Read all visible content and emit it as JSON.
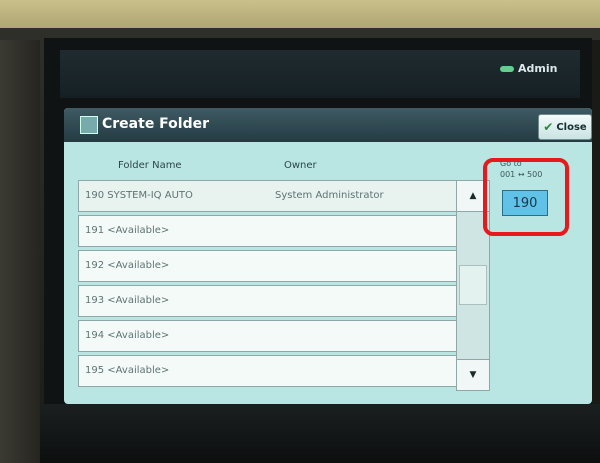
{
  "status": {
    "user_label": "Admin"
  },
  "dialog": {
    "title": "Create Folder",
    "close_label": "Close",
    "columns": {
      "folder_name": "Folder Name",
      "owner": "Owner"
    },
    "rows": [
      {
        "folder": "190 SYSTEM-IQ AUTO",
        "owner": "System Administrator"
      },
      {
        "folder": "191 <Available>",
        "owner": ""
      },
      {
        "folder": "192 <Available>",
        "owner": ""
      },
      {
        "folder": "193 <Available>",
        "owner": ""
      },
      {
        "folder": "194 <Available>",
        "owner": ""
      },
      {
        "folder": "195 <Available>",
        "owner": ""
      }
    ],
    "goto": {
      "label": "Go to",
      "range": "001 ↔ 500",
      "value": "190"
    }
  },
  "icons": {
    "user": "admin-key-icon",
    "title": "folder-tool-icon",
    "close": "checkmark-icon",
    "scroll_up": "triangle-up-icon",
    "scroll_down": "triangle-down-icon"
  },
  "colors": {
    "highlight": "#e8191d",
    "accent": "#5fc2e6"
  }
}
